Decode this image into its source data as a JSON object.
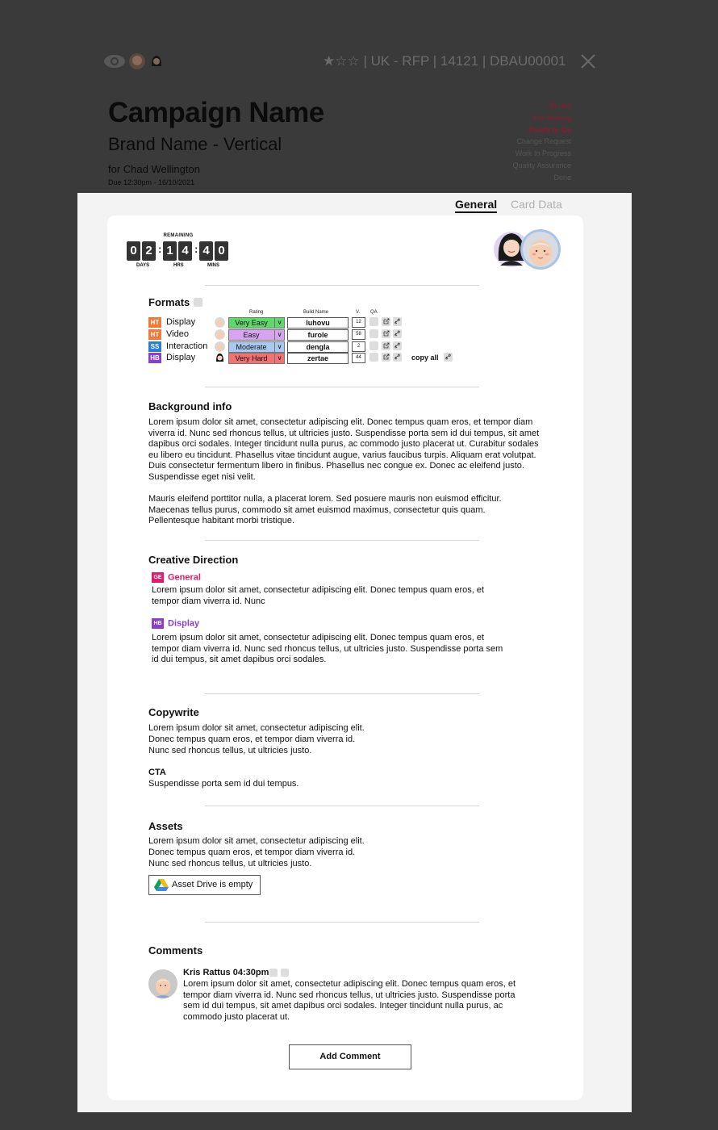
{
  "header": {
    "meta_line": "★☆☆ | UK - RFP | 14121 | DBAU00001",
    "campaign_title": "Campaign Name",
    "brand_line": "Brand Name - Vertical",
    "for_line": "for Chad Wellington",
    "due_line": "Due 12:30pm - 16/10/2021"
  },
  "status_list": [
    {
      "label": "To rate",
      "color": "#8b1b2e",
      "bold": false
    },
    {
      "label": "Info Missing",
      "color": "#8b1b2e",
      "bold": false
    },
    {
      "label": "Ready to Go",
      "color": "#8b1b2e",
      "bold": true
    },
    {
      "label": "Change Request",
      "color": "#555555",
      "bold": false
    },
    {
      "label": "Work In Progress",
      "color": "#555555",
      "bold": false
    },
    {
      "label": "Quality Assurance",
      "color": "#555555",
      "bold": false
    },
    {
      "label": "Done",
      "color": "#555555",
      "bold": false
    }
  ],
  "tabs": {
    "general": "General",
    "card_data": "Card Data"
  },
  "countdown": {
    "remaining_label": "REMAINING",
    "days": [
      "0",
      "2"
    ],
    "hours": [
      "1",
      "4"
    ],
    "mins": [
      "4",
      "0"
    ],
    "days_label": "DAYS",
    "hrs_label": "HRS",
    "mins_label": "MINS"
  },
  "formats": {
    "title": "Formats",
    "col_rating": "Rating",
    "col_build": "Build Name",
    "col_v": "V.",
    "col_qa": "QA",
    "rows": [
      {
        "badge": "HT",
        "badge_color": "#f07a3a",
        "name": "Display",
        "rating": "Very Easy",
        "rating_color": "#5fd86b",
        "build": "luhovu",
        "v": "12"
      },
      {
        "badge": "HT",
        "badge_color": "#f07a3a",
        "name": "Video",
        "rating": "Easy",
        "rating_color": "#d7a4f2",
        "build": "furole",
        "v": "58"
      },
      {
        "badge": "SS",
        "badge_color": "#2a7fd4",
        "name": "Interaction",
        "rating": "Moderate",
        "rating_color": "#a9c9f2",
        "build": "dengla",
        "v": "2"
      },
      {
        "badge": "HB",
        "badge_color": "#8b3fc4",
        "name": "Display",
        "rating": "Very Hard",
        "rating_color": "#f27272",
        "build": "zertae",
        "v": "44"
      }
    ],
    "copy_all": "copy all"
  },
  "background": {
    "title": "Background info",
    "para1": "Lorem ipsum dolor sit amet, consectetur adipiscing elit. Donec tempus quam eros, et tempor diam viverra id. Nunc sed rhoncus tellus, ut ultricies justo. Suspendisse porta sem id dui tempus, sit amet dapibus orci sodales. Integer tincidunt nulla purus, ac commodo justo placerat ut. Curabitur sodales eu libero eu tincidunt. Phasellus vitae tincidunt augue, varius faucibus turpis. Aliquam erat volutpat. Duis consectetur fermentum libero in finibus. Phasellus nec congue ex. Donec ac eleifend justo. Suspendisse eget nisi velit.",
    "para2": "Mauris eleifend porttitor nulla, a placerat lorem. Sed posuere mauris non euismod efficitur. Maecenas tellus purus, commodo sit amet euismod maximus, consectetur quis quam. Pellentesque habitant morbi tristique."
  },
  "creative": {
    "title": "Creative Direction",
    "general_badge": "GE",
    "general_badge_color": "#e8196b",
    "general_label": "General",
    "general_text": "Lorem ipsum dolor sit amet, consectetur adipiscing elit. Donec tempus quam eros, et tempor diam viverra id. Nunc",
    "display_badge": "HB",
    "display_badge_color": "#8b3fc4",
    "display_label": "Display",
    "display_text": "Lorem ipsum dolor sit amet, consectetur adipiscing elit. Donec tempus quam eros, et tempor diam viverra id. Nunc sed rhoncus tellus, ut ultricies justo. Suspendisse porta sem id dui tempus, sit amet dapibus orci sodales."
  },
  "copywrite": {
    "title": "Copywrite",
    "line1": "Lorem ipsum dolor sit amet, consectetur adipiscing elit.",
    "line2": "Donec tempus quam eros, et tempor diam viverra id.",
    "line3": "Nunc sed rhoncus tellus, ut ultricies justo.",
    "cta_label": "CTA",
    "cta_text": "Suspendisse porta sem id dui tempus."
  },
  "assets": {
    "title": "Assets",
    "line1": "Lorem ipsum dolor sit amet, consectetur adipiscing elit.",
    "line2": "Donec tempus quam eros, et tempor diam viverra id.",
    "line3": "Nunc sed rhoncus tellus, ut ultricies justo.",
    "drive_button": "Asset Drive is empty"
  },
  "comments": {
    "title": "Comments",
    "author_time": "Kris Rattus 04:30pm",
    "text": "Lorem ipsum dolor sit amet, consectetur adipiscing elit. Donec tempus quam eros, et tempor diam viverra id. Nunc sed rhoncus tellus, ut ultricies justo. Suspendisse porta sem id dui tempus, sit amet dapibus orci sodales. Integer tincidunt nulla purus, ac commodo justo placerat ut.",
    "add_button": "Add Comment"
  }
}
